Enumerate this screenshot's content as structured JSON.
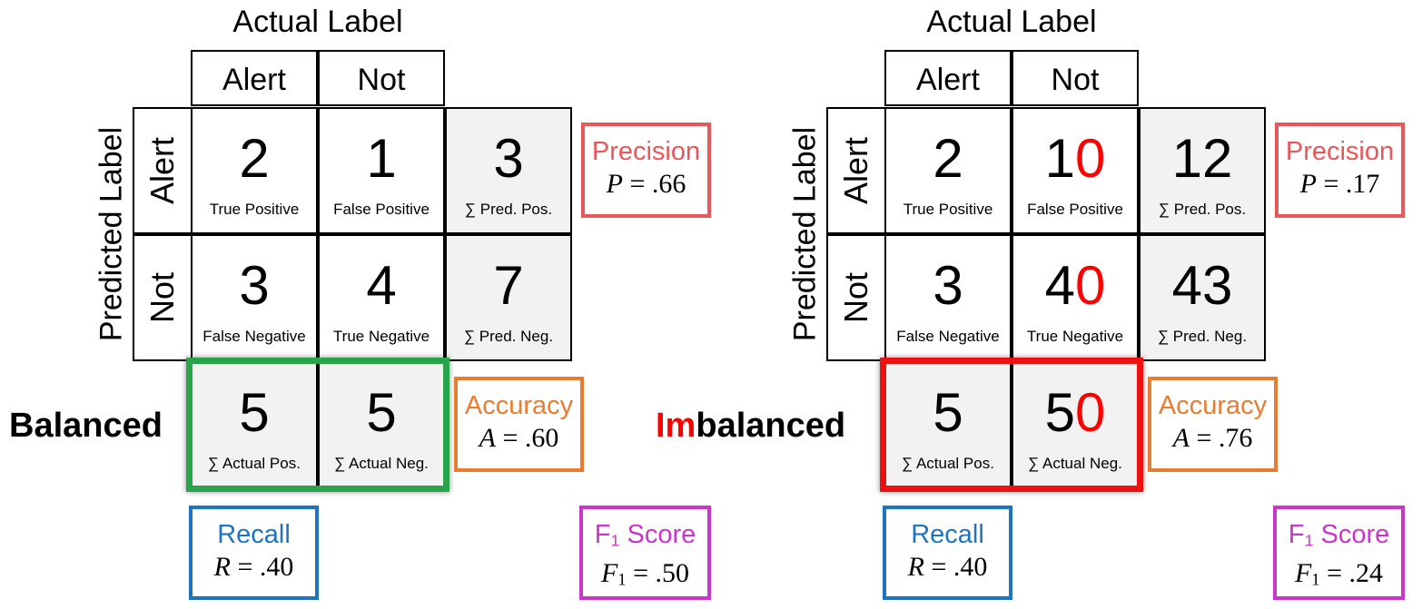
{
  "colors": {
    "precision": "#e8585a",
    "accuracy": "#e87d32",
    "recall": "#1f74bf",
    "f1": "#c936c9",
    "highlight_balanced": "#2aa44a",
    "highlight_imbalanced": "#ee1111",
    "emphasis": "#ff0000"
  },
  "actual_label_title": "Actual Label",
  "predicted_label_title": "Predicted Label",
  "col_headers": [
    "Alert",
    "Not"
  ],
  "row_headers": [
    "Alert",
    "Not"
  ],
  "cell_labels": {
    "tp": "True Positive",
    "fp": "False Positive",
    "pred_pos": "∑ Pred. Pos.",
    "fn": "False Negative",
    "tn": "True Negative",
    "pred_neg": "∑ Pred. Neg.",
    "actual_pos": "∑ Actual Pos.",
    "actual_neg": "∑ Actual Neg."
  },
  "metric_names": {
    "precision": "Precision",
    "accuracy": "Accuracy",
    "recall": "Recall",
    "f1_main": "F",
    "f1_sub": "1",
    "f1_rest": " Score"
  },
  "metric_symbols": {
    "precision": "P",
    "accuracy": "A",
    "recall": "R",
    "f1": "F",
    "f1_sub": "1"
  },
  "balanced": {
    "label": "Balanced",
    "tp": "2",
    "fp": "1",
    "pred_pos": "3",
    "fn": "3",
    "tn": "4",
    "pred_neg": "7",
    "actual_pos": "5",
    "actual_neg": "5",
    "precision": " = .66",
    "accuracy": " = .60",
    "recall": " = .40",
    "f1": " = .50"
  },
  "imbalanced": {
    "label_emphasis": "Im",
    "label_rest": "balanced",
    "tp": "2",
    "fp_base": "1",
    "fp_extra": "0",
    "pred_pos": "12",
    "fn": "3",
    "tn_base": "4",
    "tn_extra": "0",
    "pred_neg": "43",
    "actual_pos": "5",
    "actual_neg_base": "5",
    "actual_neg_extra": "0",
    "precision": " = .17",
    "accuracy": " = .76",
    "recall": " = .40",
    "f1": " = .24"
  }
}
